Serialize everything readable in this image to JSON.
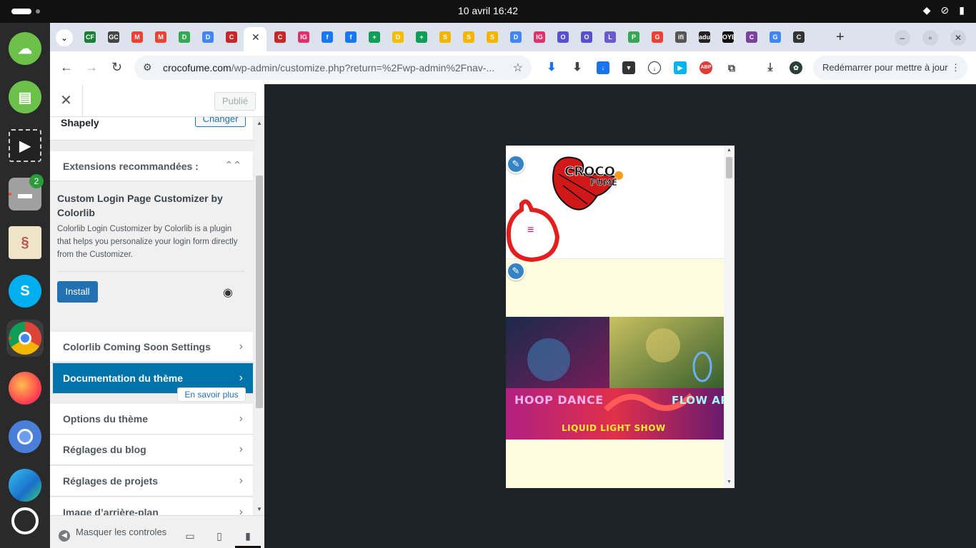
{
  "topbar": {
    "clock": "10 avril  16:42"
  },
  "dock": {
    "files_badge": "2"
  },
  "browser": {
    "url_domain": "crocofume.com",
    "url_path": "/wp-admin/customize.php?return=%2Fwp-admin%2Fnav-...",
    "restart_label": "Redémarrer pour mettre à jour",
    "tab_favicons": [
      "CF",
      "GC",
      "M",
      "M",
      "D",
      "D",
      "C",
      "C",
      "IG",
      "f",
      "f",
      "+",
      "D",
      "+",
      "S",
      "S",
      "S",
      "D",
      "IG",
      "O",
      "O",
      "L",
      "P",
      "G",
      "ific",
      "adult",
      "OYE",
      "C",
      "G",
      "C"
    ]
  },
  "customizer": {
    "publish_label": "Publié",
    "theme_name": "Shapely",
    "change_label": "Changer",
    "extensions_heading": "Extensions recommandées :",
    "plugin_title": "Custom Login Page Customizer by Colorlib",
    "plugin_desc": "Colorlib Login Customizer by Colorlib is a plugin that helps you personalize your login form directly from the Customizer.",
    "install_label": "Install",
    "learn_more": "En savoir plus",
    "sections": [
      "Colorlib Coming Soon Settings",
      "Documentation du thème",
      "Options du thème",
      "Réglages du blog",
      "Réglages de projets",
      "Image d’arrière-plan"
    ],
    "hide_controls": "Masquer les controles"
  },
  "preview": {
    "logo_line1": "CROCO",
    "logo_line2": "FUMÉ",
    "banner": {
      "left": "HOOP DANCE",
      "right": "FLOW ARTS",
      "bottom": "LIQUID LIGHT SHOW"
    }
  }
}
